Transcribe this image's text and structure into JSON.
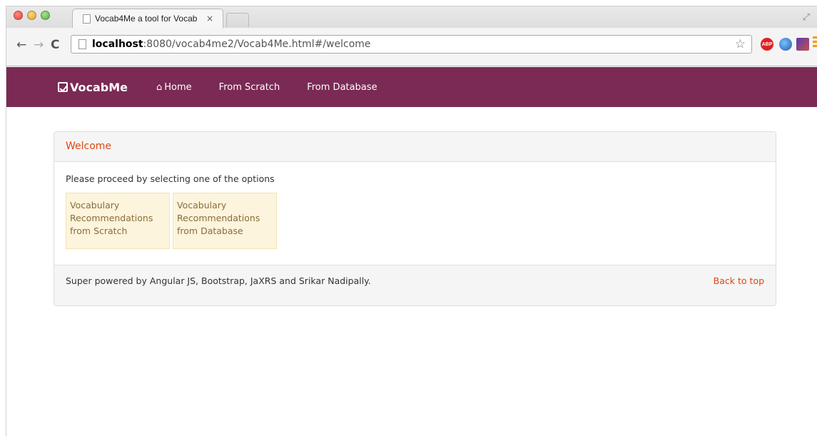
{
  "browser": {
    "tab_title": "Vocab4Me a tool for Vocab",
    "tab_close": "×",
    "url_host": "localhost",
    "url_path": ":8080/vocab4me2/Vocab4Me.html#/welcome",
    "nav_back": "←",
    "nav_forward": "→",
    "nav_reload": "C",
    "star": "☆",
    "abp_label": "ABP"
  },
  "navbar": {
    "brand": "VocabMe",
    "home_icon": "⌂",
    "items": [
      "Home",
      "From Scratch",
      "From Database"
    ],
    "background": "#7a2a54"
  },
  "panel": {
    "heading": "Welcome",
    "intro": "Please proceed by selecting one of the options",
    "options": [
      "Vocabulary Recommendations from Scratch",
      "Vocabulary Recommendations from Database"
    ],
    "footer_text_prefix": "Super powered by Angular JS, Bootstrap, JaXRS and ",
    "footer_author": "Srikar Nadipally",
    "footer_text_suffix": ".",
    "back_to_top": "Back to top",
    "accent": "#dd4814"
  }
}
